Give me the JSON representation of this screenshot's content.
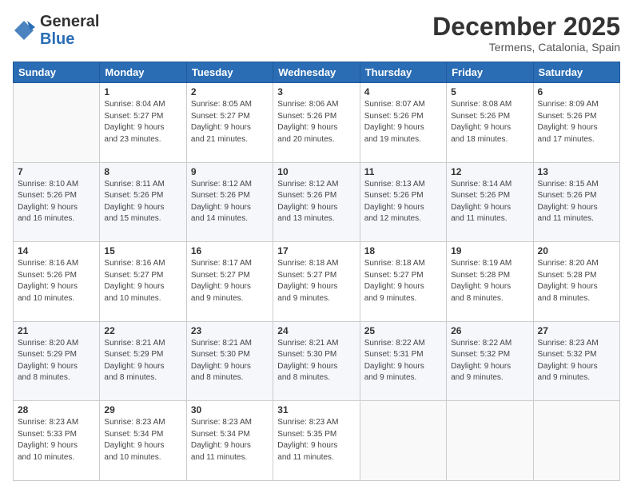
{
  "logo": {
    "general": "General",
    "blue": "Blue"
  },
  "header": {
    "month": "December 2025",
    "location": "Termens, Catalonia, Spain"
  },
  "weekdays": [
    "Sunday",
    "Monday",
    "Tuesday",
    "Wednesday",
    "Thursday",
    "Friday",
    "Saturday"
  ],
  "weeks": [
    [
      {
        "day": "",
        "sunrise": "",
        "sunset": "",
        "daylight": ""
      },
      {
        "day": "1",
        "sunrise": "Sunrise: 8:04 AM",
        "sunset": "Sunset: 5:27 PM",
        "daylight": "Daylight: 9 hours and 23 minutes."
      },
      {
        "day": "2",
        "sunrise": "Sunrise: 8:05 AM",
        "sunset": "Sunset: 5:27 PM",
        "daylight": "Daylight: 9 hours and 21 minutes."
      },
      {
        "day": "3",
        "sunrise": "Sunrise: 8:06 AM",
        "sunset": "Sunset: 5:26 PM",
        "daylight": "Daylight: 9 hours and 20 minutes."
      },
      {
        "day": "4",
        "sunrise": "Sunrise: 8:07 AM",
        "sunset": "Sunset: 5:26 PM",
        "daylight": "Daylight: 9 hours and 19 minutes."
      },
      {
        "day": "5",
        "sunrise": "Sunrise: 8:08 AM",
        "sunset": "Sunset: 5:26 PM",
        "daylight": "Daylight: 9 hours and 18 minutes."
      },
      {
        "day": "6",
        "sunrise": "Sunrise: 8:09 AM",
        "sunset": "Sunset: 5:26 PM",
        "daylight": "Daylight: 9 hours and 17 minutes."
      }
    ],
    [
      {
        "day": "7",
        "sunrise": "Sunrise: 8:10 AM",
        "sunset": "Sunset: 5:26 PM",
        "daylight": "Daylight: 9 hours and 16 minutes."
      },
      {
        "day": "8",
        "sunrise": "Sunrise: 8:11 AM",
        "sunset": "Sunset: 5:26 PM",
        "daylight": "Daylight: 9 hours and 15 minutes."
      },
      {
        "day": "9",
        "sunrise": "Sunrise: 8:12 AM",
        "sunset": "Sunset: 5:26 PM",
        "daylight": "Daylight: 9 hours and 14 minutes."
      },
      {
        "day": "10",
        "sunrise": "Sunrise: 8:12 AM",
        "sunset": "Sunset: 5:26 PM",
        "daylight": "Daylight: 9 hours and 13 minutes."
      },
      {
        "day": "11",
        "sunrise": "Sunrise: 8:13 AM",
        "sunset": "Sunset: 5:26 PM",
        "daylight": "Daylight: 9 hours and 12 minutes."
      },
      {
        "day": "12",
        "sunrise": "Sunrise: 8:14 AM",
        "sunset": "Sunset: 5:26 PM",
        "daylight": "Daylight: 9 hours and 11 minutes."
      },
      {
        "day": "13",
        "sunrise": "Sunrise: 8:15 AM",
        "sunset": "Sunset: 5:26 PM",
        "daylight": "Daylight: 9 hours and 11 minutes."
      }
    ],
    [
      {
        "day": "14",
        "sunrise": "Sunrise: 8:16 AM",
        "sunset": "Sunset: 5:26 PM",
        "daylight": "Daylight: 9 hours and 10 minutes."
      },
      {
        "day": "15",
        "sunrise": "Sunrise: 8:16 AM",
        "sunset": "Sunset: 5:27 PM",
        "daylight": "Daylight: 9 hours and 10 minutes."
      },
      {
        "day": "16",
        "sunrise": "Sunrise: 8:17 AM",
        "sunset": "Sunset: 5:27 PM",
        "daylight": "Daylight: 9 hours and 9 minutes."
      },
      {
        "day": "17",
        "sunrise": "Sunrise: 8:18 AM",
        "sunset": "Sunset: 5:27 PM",
        "daylight": "Daylight: 9 hours and 9 minutes."
      },
      {
        "day": "18",
        "sunrise": "Sunrise: 8:18 AM",
        "sunset": "Sunset: 5:27 PM",
        "daylight": "Daylight: 9 hours and 9 minutes."
      },
      {
        "day": "19",
        "sunrise": "Sunrise: 8:19 AM",
        "sunset": "Sunset: 5:28 PM",
        "daylight": "Daylight: 9 hours and 8 minutes."
      },
      {
        "day": "20",
        "sunrise": "Sunrise: 8:20 AM",
        "sunset": "Sunset: 5:28 PM",
        "daylight": "Daylight: 9 hours and 8 minutes."
      }
    ],
    [
      {
        "day": "21",
        "sunrise": "Sunrise: 8:20 AM",
        "sunset": "Sunset: 5:29 PM",
        "daylight": "Daylight: 9 hours and 8 minutes."
      },
      {
        "day": "22",
        "sunrise": "Sunrise: 8:21 AM",
        "sunset": "Sunset: 5:29 PM",
        "daylight": "Daylight: 9 hours and 8 minutes."
      },
      {
        "day": "23",
        "sunrise": "Sunrise: 8:21 AM",
        "sunset": "Sunset: 5:30 PM",
        "daylight": "Daylight: 9 hours and 8 minutes."
      },
      {
        "day": "24",
        "sunrise": "Sunrise: 8:21 AM",
        "sunset": "Sunset: 5:30 PM",
        "daylight": "Daylight: 9 hours and 8 minutes."
      },
      {
        "day": "25",
        "sunrise": "Sunrise: 8:22 AM",
        "sunset": "Sunset: 5:31 PM",
        "daylight": "Daylight: 9 hours and 9 minutes."
      },
      {
        "day": "26",
        "sunrise": "Sunrise: 8:22 AM",
        "sunset": "Sunset: 5:32 PM",
        "daylight": "Daylight: 9 hours and 9 minutes."
      },
      {
        "day": "27",
        "sunrise": "Sunrise: 8:23 AM",
        "sunset": "Sunset: 5:32 PM",
        "daylight": "Daylight: 9 hours and 9 minutes."
      }
    ],
    [
      {
        "day": "28",
        "sunrise": "Sunrise: 8:23 AM",
        "sunset": "Sunset: 5:33 PM",
        "daylight": "Daylight: 9 hours and 10 minutes."
      },
      {
        "day": "29",
        "sunrise": "Sunrise: 8:23 AM",
        "sunset": "Sunset: 5:34 PM",
        "daylight": "Daylight: 9 hours and 10 minutes."
      },
      {
        "day": "30",
        "sunrise": "Sunrise: 8:23 AM",
        "sunset": "Sunset: 5:34 PM",
        "daylight": "Daylight: 9 hours and 11 minutes."
      },
      {
        "day": "31",
        "sunrise": "Sunrise: 8:23 AM",
        "sunset": "Sunset: 5:35 PM",
        "daylight": "Daylight: 9 hours and 11 minutes."
      },
      {
        "day": "",
        "sunrise": "",
        "sunset": "",
        "daylight": ""
      },
      {
        "day": "",
        "sunrise": "",
        "sunset": "",
        "daylight": ""
      },
      {
        "day": "",
        "sunrise": "",
        "sunset": "",
        "daylight": ""
      }
    ]
  ]
}
